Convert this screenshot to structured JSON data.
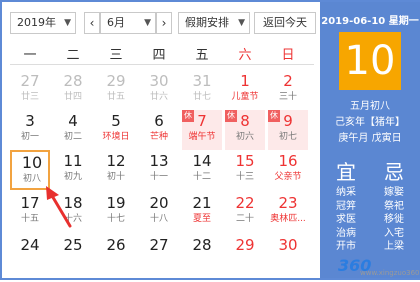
{
  "toolbar": {
    "year": "2019年",
    "month": "6月",
    "holiday": "假期安排",
    "today": "返回今天"
  },
  "weekdays": [
    "一",
    "二",
    "三",
    "四",
    "五",
    "六",
    "日"
  ],
  "weeks": [
    [
      {
        "d": "27",
        "l": "廿三",
        "other": true
      },
      {
        "d": "28",
        "l": "廿四",
        "other": true
      },
      {
        "d": "29",
        "l": "廿五",
        "other": true
      },
      {
        "d": "30",
        "l": "廿六",
        "other": true
      },
      {
        "d": "31",
        "l": "廿七",
        "other": true
      },
      {
        "d": "1",
        "l": "儿童节",
        "fest": true,
        "red": true
      },
      {
        "d": "2",
        "l": "三十",
        "red": true
      }
    ],
    [
      {
        "d": "3",
        "l": "初一"
      },
      {
        "d": "4",
        "l": "初二"
      },
      {
        "d": "5",
        "l": "环境日",
        "fest": true
      },
      {
        "d": "6",
        "l": "芒种",
        "fest": true
      },
      {
        "d": "7",
        "l": "端午节",
        "fest": true,
        "red": true,
        "rest": true,
        "tag": "休"
      },
      {
        "d": "8",
        "l": "初六",
        "red": true,
        "rest": true,
        "tag": "休"
      },
      {
        "d": "9",
        "l": "初七",
        "red": true,
        "rest": true,
        "tag": "休"
      }
    ],
    [
      {
        "d": "10",
        "l": "初八",
        "sel": true
      },
      {
        "d": "11",
        "l": "初九"
      },
      {
        "d": "12",
        "l": "初十"
      },
      {
        "d": "13",
        "l": "十一"
      },
      {
        "d": "14",
        "l": "十二"
      },
      {
        "d": "15",
        "l": "十三",
        "red": true
      },
      {
        "d": "16",
        "l": "父亲节",
        "fest": true,
        "red": true
      }
    ],
    [
      {
        "d": "17",
        "l": "十五"
      },
      {
        "d": "18",
        "l": "十六"
      },
      {
        "d": "19",
        "l": "十七"
      },
      {
        "d": "20",
        "l": "十八"
      },
      {
        "d": "21",
        "l": "夏至",
        "fest": true
      },
      {
        "d": "22",
        "l": "二十",
        "red": true
      },
      {
        "d": "23",
        "l": "奥林匹...",
        "fest": true,
        "red": true
      }
    ],
    [
      {
        "d": "24",
        "l": "",
        "clip": true
      },
      {
        "d": "25",
        "l": "",
        "clip": true
      },
      {
        "d": "26",
        "l": "",
        "clip": true
      },
      {
        "d": "27",
        "l": "",
        "clip": true
      },
      {
        "d": "28",
        "l": "",
        "clip": true
      },
      {
        "d": "29",
        "l": "",
        "clip": true,
        "red": true
      },
      {
        "d": "30",
        "l": "",
        "clip": true,
        "red": true
      }
    ]
  ],
  "panel": {
    "date_line": "2019-06-10 星期一",
    "big_day": "10",
    "lunar": [
      "五月初八",
      "己亥年【猪年】",
      "庚午月 戊寅日"
    ],
    "yi_title": "宜",
    "ji_title": "忌",
    "yi": [
      "纳采",
      "冠笄",
      "求医",
      "治病",
      "开市"
    ],
    "ji": [
      "嫁娶",
      "祭祀",
      "移徙",
      "入宅",
      "上梁"
    ]
  },
  "watermark": {
    "brand": "360",
    "site": "www.xingzuo360.cn"
  },
  "colors": {
    "accent": "#5b87d2",
    "today": "#f7a600",
    "holiday": "#e33333",
    "rest_bg": "#fde9e9"
  }
}
